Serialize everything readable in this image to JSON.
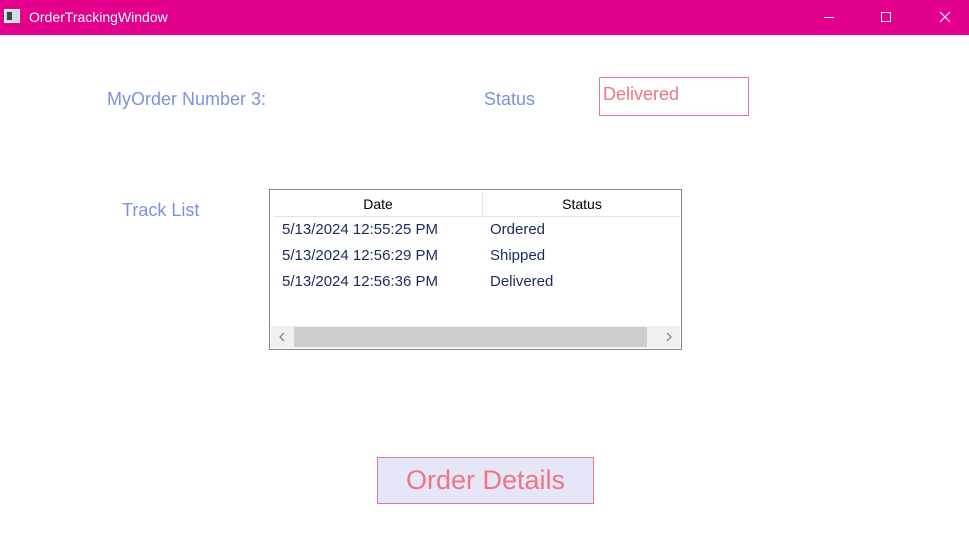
{
  "window": {
    "title": "OrderTrackingWindow",
    "titlebar_color": "#e3008c",
    "icons": {
      "app": "app-window-icon",
      "minimize": "minimize-icon",
      "maximize": "maximize-icon",
      "close": "close-icon"
    }
  },
  "order": {
    "label": "MyOrder Number 3:",
    "status_label": "Status",
    "status_value": "Delivered"
  },
  "track_list": {
    "label": "Track List",
    "columns": [
      "Date",
      "Status"
    ],
    "rows": [
      {
        "date": "5/13/2024 12:55:25 PM",
        "status": "Ordered"
      },
      {
        "date": "5/13/2024 12:56:29 PM",
        "status": "Shipped"
      },
      {
        "date": "5/13/2024 12:56:36 PM",
        "status": "Delivered"
      }
    ]
  },
  "actions": {
    "order_details_label": "Order Details"
  },
  "colors": {
    "label_blue": "#7b93dc",
    "accent_pink": "#ee7584",
    "button_bg": "#e6e6f9"
  }
}
